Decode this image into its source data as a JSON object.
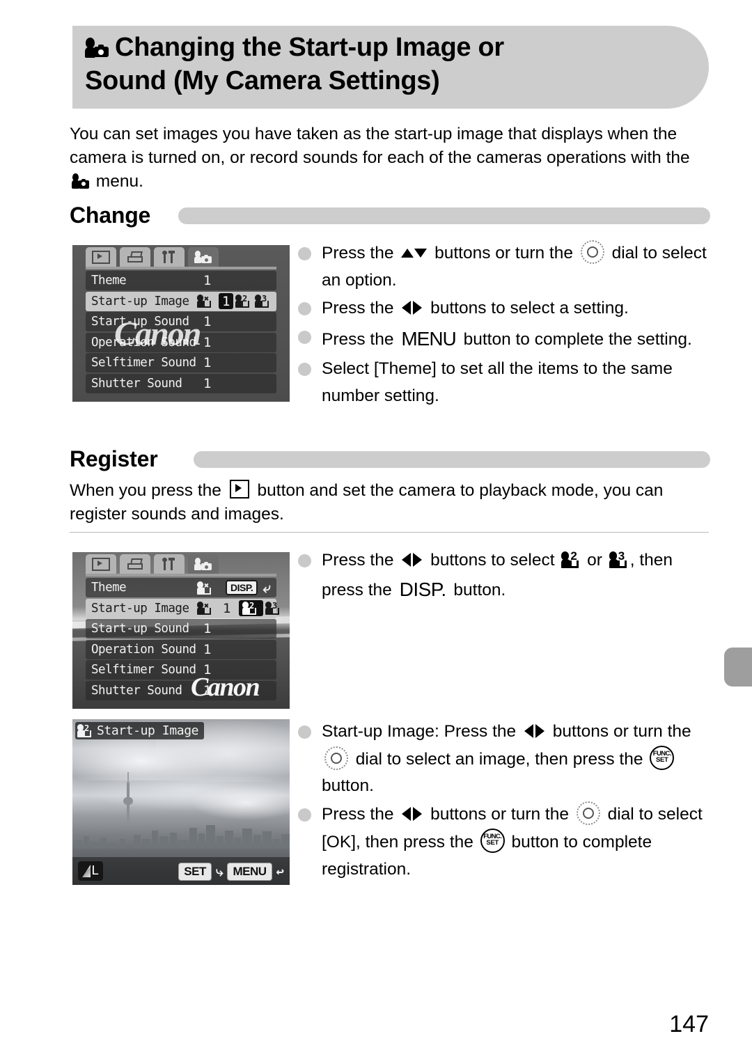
{
  "page": {
    "number": "147"
  },
  "title": {
    "icon": "my-camera-icon",
    "line1": "Changing the Start-up Image or",
    "line2": "Sound (My Camera Settings)"
  },
  "intro": {
    "part1": "You can set images you have taken as the start-up image that displays when the camera is turned on, or record sounds for each of the cameras operations with the ",
    "part2": " menu."
  },
  "sections": {
    "change": {
      "label": "Change"
    },
    "register": {
      "label": "Register",
      "paragraph_part1": "When you press the ",
      "paragraph_part2": " button and set the camera to playback mode, you can register sounds and images."
    }
  },
  "bullets_change": [
    {
      "t1": "Press the ",
      "g1": "up-down-buttons-icon",
      "t2": " buttons or turn the ",
      "g2": "control-dial-icon",
      "t3": " dial to select an option."
    },
    {
      "t1": "Press the ",
      "g1": "left-right-buttons-icon",
      "t2": " buttons to select a setting.",
      "t3": ""
    },
    {
      "t1": "Press the ",
      "g1": "menu-button-icon",
      "t2": " button to complete the setting.",
      "t3": ""
    },
    {
      "t1": "Select [Theme] to set all the items to the same number setting.",
      "g1": "",
      "t2": "",
      "t3": ""
    }
  ],
  "bullets_register_1": [
    {
      "t1": "Press the ",
      "g1": "left-right-buttons-icon",
      "t2": " buttons to select ",
      "g2": "my-camera-2-icon",
      "t3": " or ",
      "g3": "my-camera-3-icon",
      "t4": ", then press the ",
      "g4": "disp-button-icon",
      "t5": " button."
    }
  ],
  "bullets_register_2": [
    {
      "t1": "Start-up Image: Press the ",
      "g1": "left-right-buttons-icon",
      "t2": " buttons or turn the ",
      "g2": "control-dial-icon",
      "t3": " dial to select an image, then press the ",
      "g3": "func-set-button-icon",
      "t4": " button."
    },
    {
      "t1": "Press the ",
      "g1": "left-right-buttons-icon",
      "t2": " buttons or turn the ",
      "g2": "control-dial-icon",
      "t3": " dial to select [OK], then press the ",
      "g3": "func-set-button-icon",
      "t4": " button to complete registration."
    }
  ],
  "lcd_menu_1": {
    "tabs": [
      "playback-tab",
      "print-tab",
      "settings-tab",
      "my-camera-tab"
    ],
    "active_tab": "my-camera-tab",
    "watermark": "Canon",
    "rows": [
      {
        "name": "Theme",
        "value": "1",
        "type": "value",
        "highlight": false
      },
      {
        "name": "Start-up Image",
        "value": "",
        "type": "options",
        "highlight": true,
        "options": [
          "off",
          "1",
          "2",
          "3"
        ],
        "selected": "1"
      },
      {
        "name": "Start-up Sound",
        "value": "1",
        "type": "value",
        "highlight": false
      },
      {
        "name": "Operation Sound",
        "value": "1",
        "type": "value",
        "highlight": false
      },
      {
        "name": "Selftimer Sound",
        "value": "1",
        "type": "value",
        "highlight": false
      },
      {
        "name": "Shutter Sound",
        "value": "1",
        "type": "value",
        "highlight": false
      }
    ]
  },
  "lcd_menu_2": {
    "tabs": [
      "playback-tab",
      "print-tab",
      "settings-tab",
      "my-camera-tab"
    ],
    "active_tab": "my-camera-tab",
    "watermark": "Canon",
    "disp_badge": "DISP.",
    "rows": [
      {
        "name": "Theme",
        "value": "",
        "type": "theme",
        "highlight": false
      },
      {
        "name": "Start-up Image",
        "value": "",
        "type": "options",
        "highlight": true,
        "options": [
          "off",
          "1",
          "2",
          "3"
        ],
        "selected": "2"
      },
      {
        "name": "Start-up Sound",
        "value": "1",
        "type": "value",
        "highlight": false
      },
      {
        "name": "Operation Sound",
        "value": "1",
        "type": "value",
        "highlight": false
      },
      {
        "name": "Selftimer Sound",
        "value": "1",
        "type": "value",
        "highlight": false
      },
      {
        "name": "Shutter Sound",
        "value": "1",
        "type": "value",
        "highlight": false
      }
    ]
  },
  "lcd_preview": {
    "title": "Start-up Image",
    "title_icon": "my-camera-2-icon",
    "quality_badge": "L",
    "set_button": "SET",
    "menu_button": "MENU",
    "photo_description": "city-skyline-photo"
  }
}
